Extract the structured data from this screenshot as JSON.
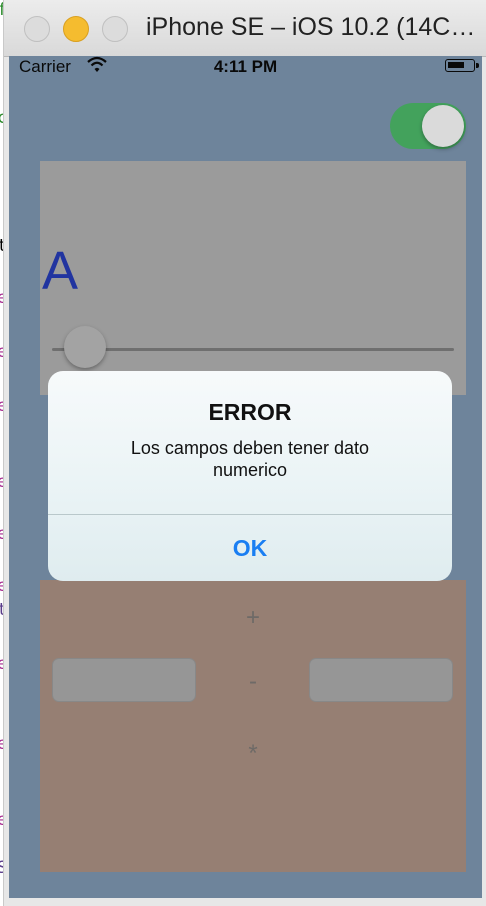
{
  "window": {
    "title": "iPhone SE – iOS 10.2 (14C…"
  },
  "background_code": {
    "glyphs": [
      "f",
      "c",
      "t",
      "e",
      "e",
      "e",
      "e",
      "e",
      "e",
      "t",
      "e",
      "e",
      "e",
      "S"
    ]
  },
  "status_bar": {
    "carrier": "Carrier",
    "time": "4:11 PM",
    "wifi_icon": "wifi-icon",
    "battery_icon": "battery-icon"
  },
  "controls": {
    "switch_on": true,
    "label_text": "A",
    "slider_value_fraction": 0.16
  },
  "operators": {
    "plus": "+",
    "minus": "-",
    "multiply": "*"
  },
  "alert": {
    "title": "ERROR",
    "message": "Los campos deben tener dato numerico",
    "button": "OK"
  },
  "colors": {
    "screen_background": "#6e869f",
    "switch_on": "#3fa75b",
    "label_text": "#1b2fa4",
    "alert_button": "#1a7ef2",
    "bottom_panel": "#9a8073"
  }
}
